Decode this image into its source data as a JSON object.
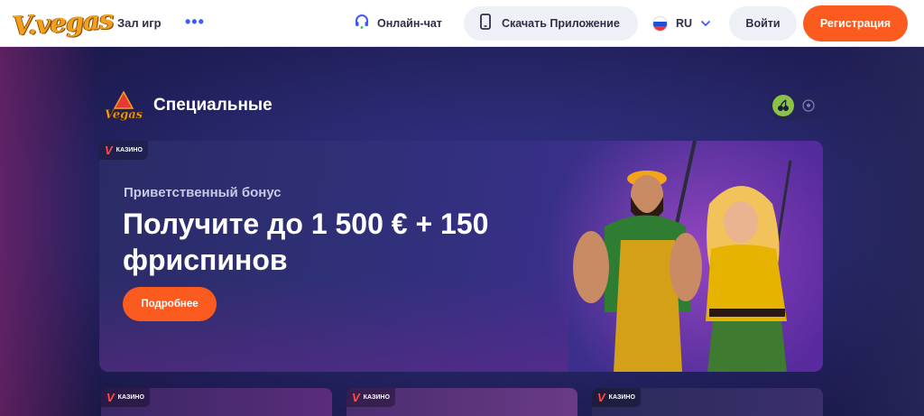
{
  "header": {
    "logo_text": "V.vegas",
    "nav_games": "Зал игр",
    "nav_more": "•••",
    "chat_label": "Онлайн-чат",
    "app_label": "Скачать Приложение",
    "lang_label": "RU",
    "login_label": "Войти",
    "register_label": "Регистрация"
  },
  "section": {
    "logo_text": "Vegas",
    "title": "Специальные"
  },
  "hero": {
    "badge": "КАЗИНО",
    "subtitle": "Приветственный бонус",
    "title": "Получите до 1 500 € + 150 фриспинов",
    "button": "Подробнее"
  },
  "cards": [
    {
      "badge": "КАЗИНО"
    },
    {
      "badge": "КАЗИНО"
    },
    {
      "badge": "КАЗИНО"
    }
  ],
  "colors": {
    "accent": "#fb5b1e",
    "link": "#3d5afe",
    "toggle_active": "#8bc34a",
    "logo": "#f3a11a"
  },
  "icons": {
    "chat": "headset-icon",
    "app": "phone-icon",
    "lang": "russia-flag-icon",
    "chevron": "chevron-down-icon",
    "toggle_on": "cherries-icon",
    "toggle_off": "soccer-ball-icon"
  }
}
